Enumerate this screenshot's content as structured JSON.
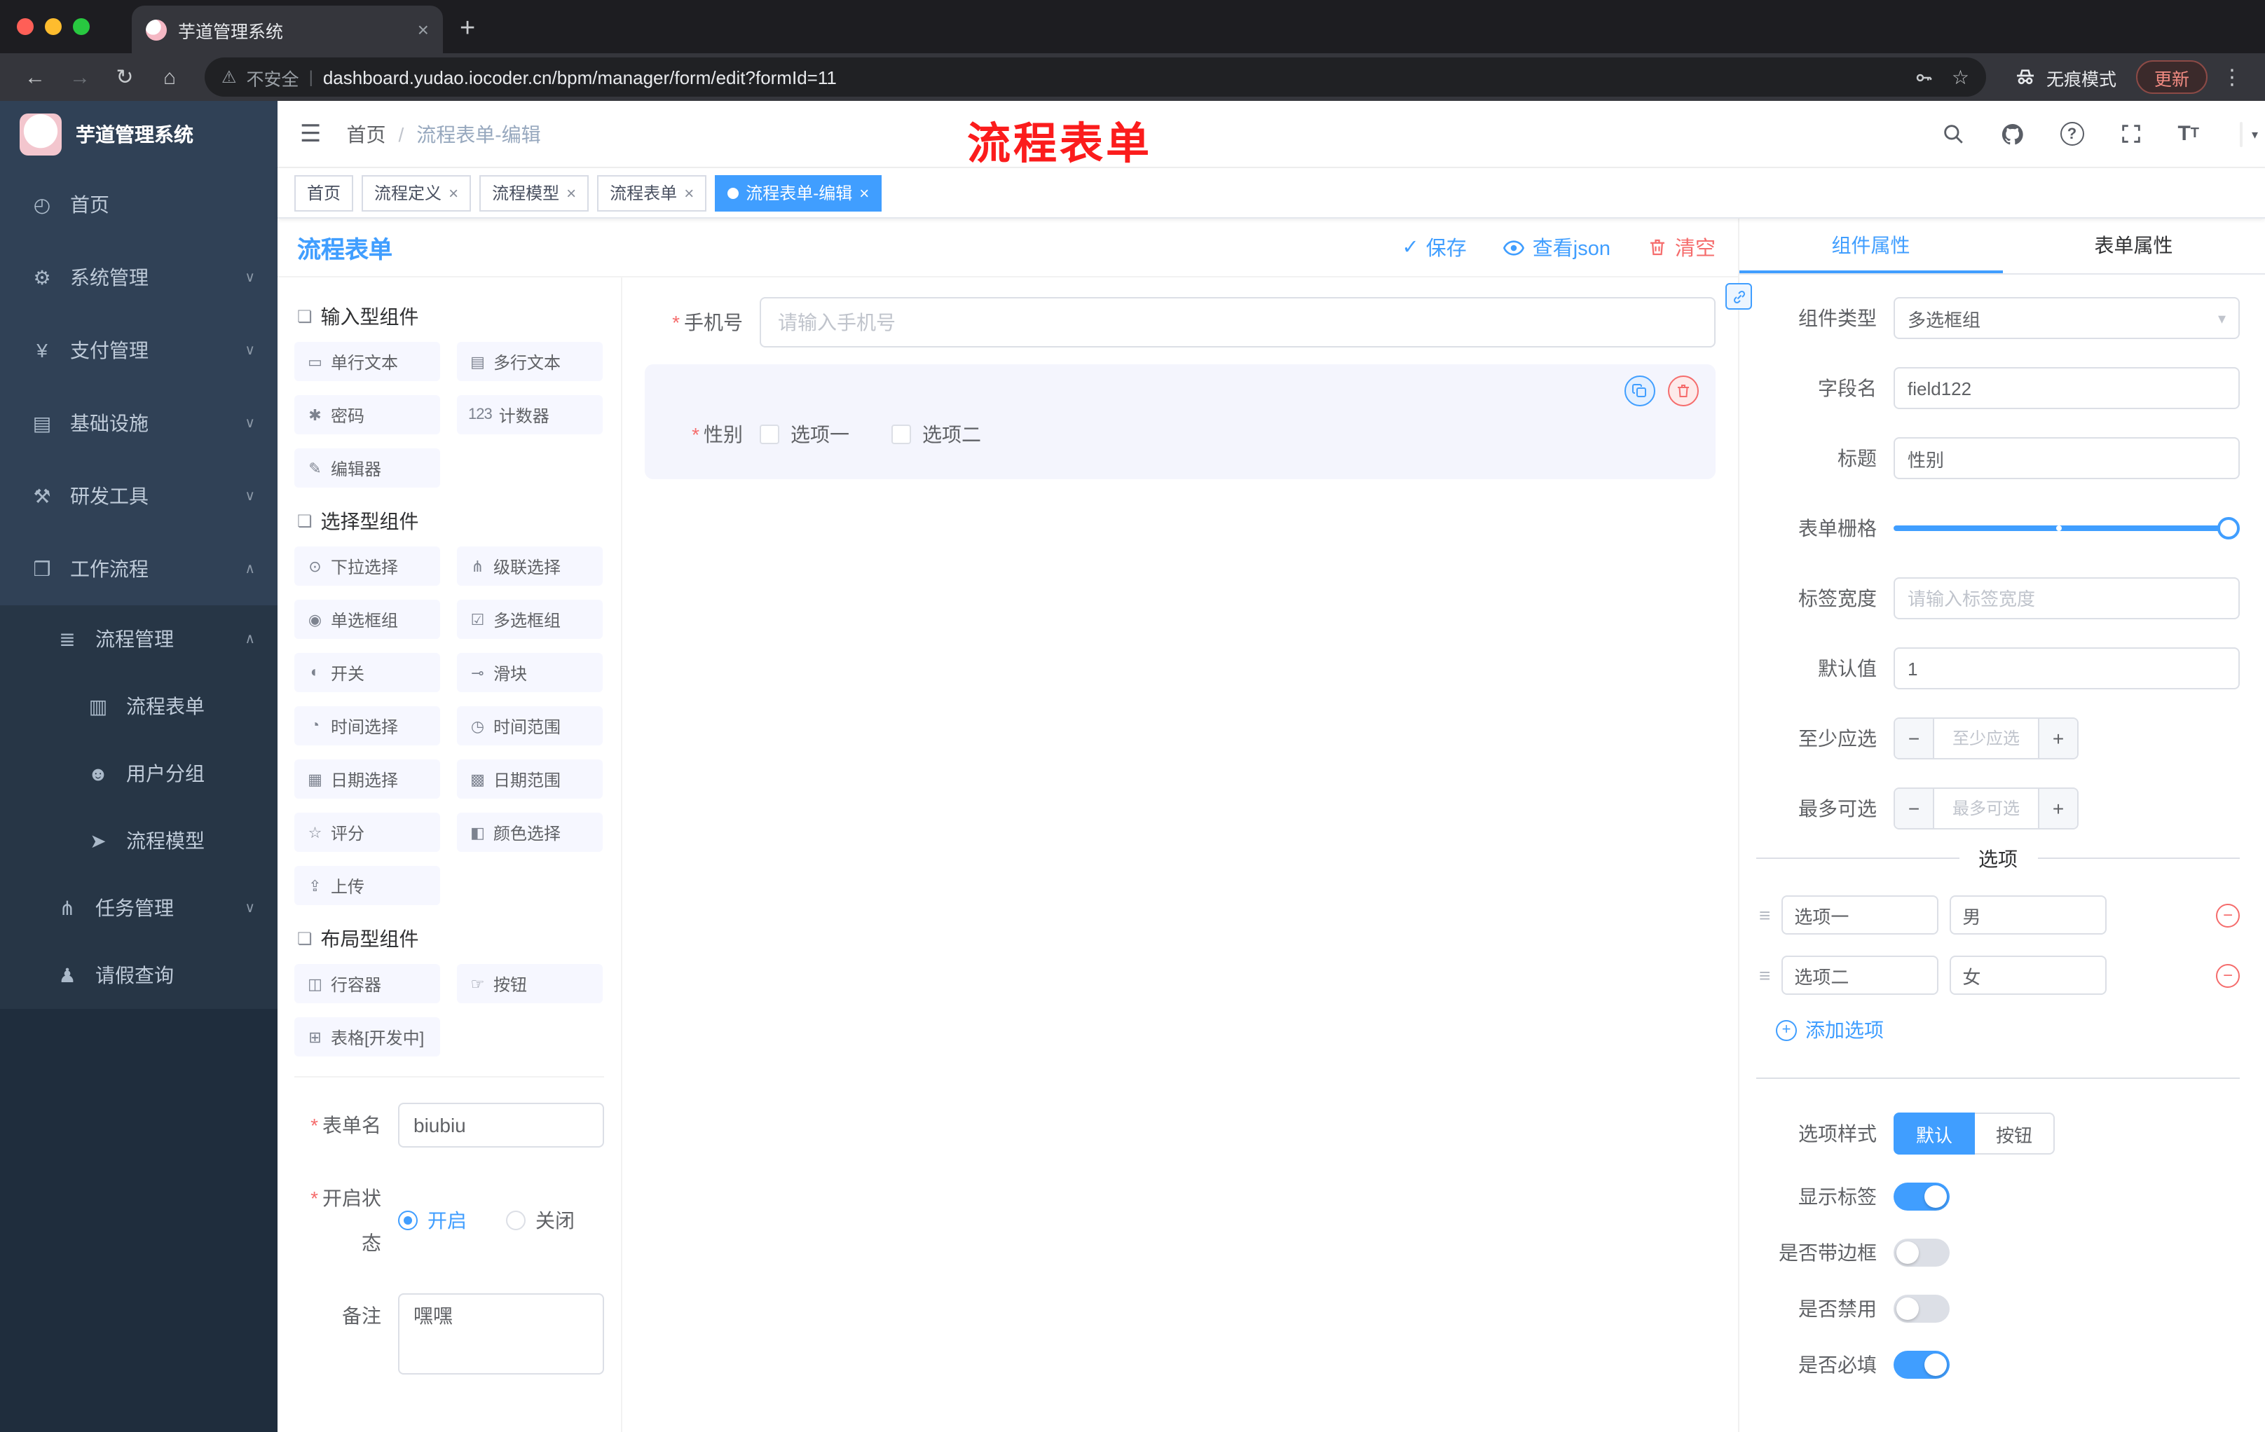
{
  "colors": {
    "accent": "#409eff",
    "danger": "#f56c6c",
    "sidebar_bg": "#304156",
    "submenu_bg": "#273646",
    "annotation_red": "#fb1c1c",
    "active_tag_bg": "#409eff"
  },
  "icons": {
    "back": "←",
    "forward": "→",
    "reload": "↻",
    "home": "⌂",
    "warning": "⚠",
    "star": "☆",
    "close": "×",
    "plus": "+",
    "more": "⋮",
    "hamburger": "☰",
    "sep": "/",
    "chevron_down": "∨",
    "chevron_up": "∧",
    "dot": "●",
    "check": "✓",
    "caret": "▾",
    "minus": "−",
    "question": "?",
    "font_size": "T",
    "drag": "≡"
  },
  "browser": {
    "tab_title": "芋道管理系统",
    "security_label": "不安全",
    "url": "dashboard.yudao.iocoder.cn/bpm/manager/form/edit?formId=11",
    "incognito_label": "无痕模式",
    "update_label": "更新"
  },
  "annotation": "流程表单",
  "sidebar": {
    "logo_title": "芋道管理系统",
    "menu": [
      {
        "icon": "◴",
        "label": "首页"
      },
      {
        "icon": "⚙",
        "label": "系统管理",
        "arrow": "∨"
      },
      {
        "icon": "¥",
        "label": "支付管理",
        "arrow": "∨"
      },
      {
        "icon": "▤",
        "label": "基础设施",
        "arrow": "∨"
      },
      {
        "icon": "⚒",
        "label": "研发工具",
        "arrow": "∨"
      },
      {
        "icon": "❒",
        "label": "工作流程",
        "arrow": "∧"
      },
      {
        "icon": "≣",
        "label": "流程管理",
        "arrow": "∧"
      },
      {
        "icon": "▥",
        "label": "流程表单"
      },
      {
        "icon": "☻",
        "label": "用户分组"
      },
      {
        "icon": "➤",
        "label": "流程模型"
      },
      {
        "icon": "⋔",
        "label": "任务管理",
        "arrow": "∨"
      },
      {
        "icon": "♟",
        "label": "请假查询"
      }
    ]
  },
  "header": {
    "breadcrumb_home": "首页",
    "breadcrumb_current": "流程表单-编辑"
  },
  "tags": [
    {
      "label": "首页"
    },
    {
      "label": "流程定义"
    },
    {
      "label": "流程模型"
    },
    {
      "label": "流程表单"
    },
    {
      "label": "流程表单-编辑"
    }
  ],
  "designer": {
    "title": "流程表单",
    "save": "保存",
    "view_json": "查看json",
    "clear": "清空",
    "palette": {
      "groups": [
        {
          "icon": "❏",
          "title": "输入型组件",
          "items": [
            {
              "icon": "▭",
              "label": "单行文本"
            },
            {
              "icon": "▤",
              "label": "多行文本"
            },
            {
              "icon": "✱",
              "label": "密码"
            },
            {
              "icon": "123",
              "label": "计数器"
            },
            {
              "icon": "✎",
              "label": "编辑器"
            }
          ]
        },
        {
          "icon": "❏",
          "title": "选择型组件",
          "items": [
            {
              "icon": "⊙",
              "label": "下拉选择"
            },
            {
              "icon": "⋔",
              "label": "级联选择"
            },
            {
              "icon": "◉",
              "label": "单选框组"
            },
            {
              "icon": "☑",
              "label": "多选框组"
            },
            {
              "icon": "◐",
              "label": "开关"
            },
            {
              "icon": "⊸",
              "label": "滑块"
            },
            {
              "icon": "◔",
              "label": "时间选择"
            },
            {
              "icon": "◷",
              "label": "时间范围"
            },
            {
              "icon": "▦",
              "label": "日期选择"
            },
            {
              "icon": "▩",
              "label": "日期范围"
            },
            {
              "icon": "☆",
              "label": "评分"
            },
            {
              "icon": "◧",
              "label": "颜色选择"
            },
            {
              "icon": "⇪",
              "label": "上传"
            }
          ]
        },
        {
          "icon": "❏",
          "title": "布局型组件",
          "items": [
            {
              "icon": "◫",
              "label": "行容器"
            },
            {
              "icon": "☞",
              "label": "按钮"
            },
            {
              "icon": "⊞",
              "label": "表格[开发中]"
            }
          ]
        }
      ]
    },
    "meta": {
      "name_label": "表单名",
      "name_value": "biubiu",
      "status_label": "开启状态",
      "status_on": "开启",
      "status_off": "关闭",
      "remark_label": "备注",
      "remark_value": "嘿嘿"
    },
    "canvas": {
      "phone_label": "手机号",
      "phone_placeholder": "请输入手机号",
      "gender_label": "性别",
      "gender_option1": "选项一",
      "gender_option2": "选项二"
    }
  },
  "props": {
    "tab_component": "组件属性",
    "tab_form": "表单属性",
    "component_type_label": "组件类型",
    "component_type_value": "多选框组",
    "field_name_label": "字段名",
    "field_name_value": "field122",
    "title_label": "标题",
    "title_value": "性别",
    "grid_label": "表单栅格",
    "label_width_label": "标签宽度",
    "label_width_placeholder": "请输入标签宽度",
    "default_label": "默认值",
    "default_value": "1",
    "min_label": "至少应选",
    "min_placeholder": "至少应选",
    "max_label": "最多可选",
    "max_placeholder": "最多可选",
    "options_title": "选项",
    "options": [
      {
        "label": "选项一",
        "value": "男"
      },
      {
        "label": "选项二",
        "value": "女"
      }
    ],
    "add_option": "添加选项",
    "style_label": "选项样式",
    "style_default": "默认",
    "style_button": "按钮",
    "show_label": "显示标签",
    "border_label": "是否带边框",
    "disabled_label": "是否禁用",
    "required_label": "是否必填",
    "switch_states": {
      "show_label": true,
      "border": false,
      "disabled": false,
      "required": true
    },
    "slider": {
      "value_percent": 100,
      "stop_percent": 47
    }
  }
}
